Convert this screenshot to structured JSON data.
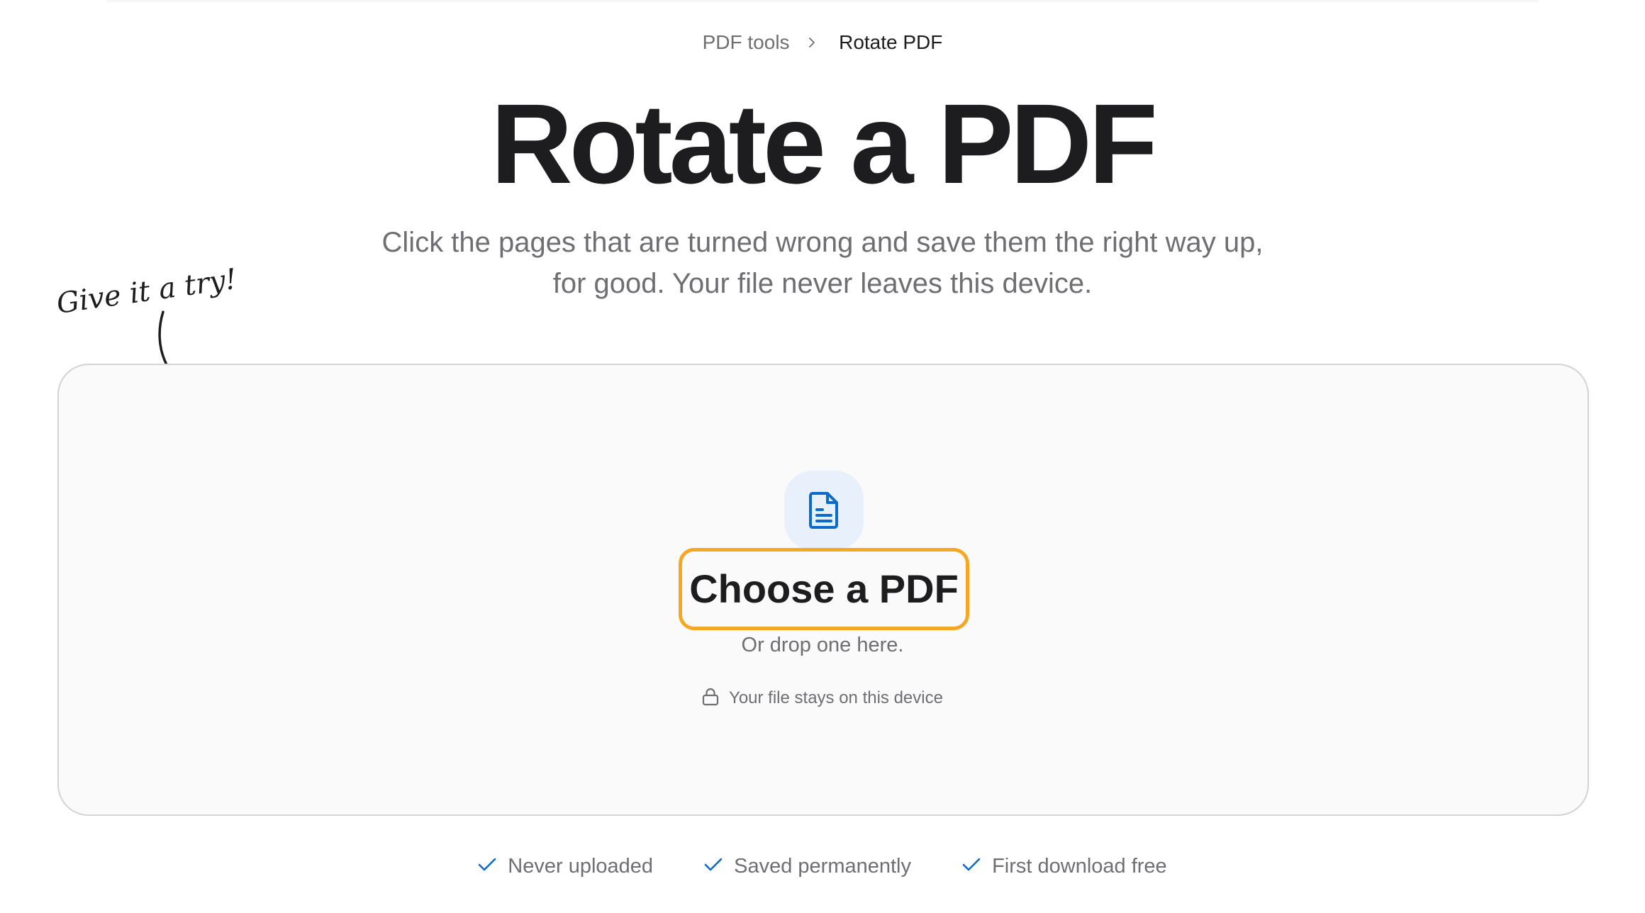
{
  "breadcrumb": {
    "parent": "PDF tools",
    "current": "Rotate PDF"
  },
  "hero": {
    "title": "Rotate a PDF",
    "subtitle_line1": "Click the pages that are turned wrong and save them the right way up,",
    "subtitle_line2": "for good. Your file never leaves this device."
  },
  "annotation": {
    "text": "Give it a try!"
  },
  "dropzone": {
    "icon": "document-icon",
    "button_label": "Choose a PDF",
    "hint": "Or drop one here.",
    "privacy_icon": "lock-icon",
    "privacy_note": "Your file stays on this device"
  },
  "features": [
    {
      "icon": "check-icon",
      "label": "Never uploaded"
    },
    {
      "icon": "check-icon",
      "label": "Saved permanently"
    },
    {
      "icon": "check-icon",
      "label": "First download free"
    }
  ],
  "colors": {
    "accent_blue": "#0b6bcb",
    "button_outline": "#f5a623",
    "badge_background": "#e8f0fc",
    "dropzone_background": "#fafafa",
    "text_primary": "#1d1d1f",
    "text_secondary": "#6e6e73"
  }
}
